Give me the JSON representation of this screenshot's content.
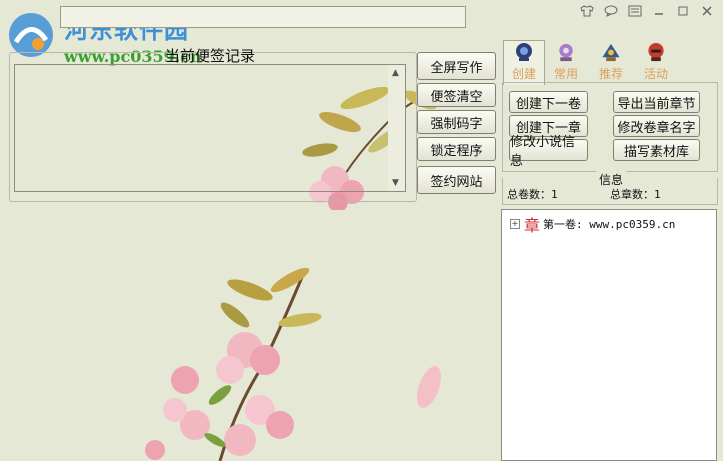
{
  "watermark": {
    "title": "河东软件园",
    "url": "www.pc0359.cn"
  },
  "window": {
    "title": "",
    "icons": [
      "shirt-icon",
      "chat-icon",
      "menu-icon",
      "minimize-icon",
      "maximize-icon",
      "close-icon"
    ]
  },
  "notes": {
    "legend": "当前便签记录",
    "content": ""
  },
  "actions": {
    "fullscreen": "全屏写作",
    "clear_notes": "便签清空",
    "force_code": "强制码字",
    "lock": "锁定程序",
    "sign_site": "签约网站"
  },
  "tabs": [
    {
      "label": "创建",
      "icon": "create-icon"
    },
    {
      "label": "常用",
      "icon": "common-icon"
    },
    {
      "label": "推荐",
      "icon": "recommend-icon"
    },
    {
      "label": "活动",
      "icon": "event-icon"
    }
  ],
  "create_panel": {
    "new_volume": "创建下一卷",
    "new_chapter": "创建下一章",
    "edit_novel": "修改小说信息",
    "export_chapter": "导出当前章节",
    "rename": "修改卷章名字",
    "material": "描写素材库"
  },
  "info": {
    "title": "信息",
    "total_volumes_label": "总卷数：",
    "total_volumes": "1",
    "total_chapters_label": "总章数：",
    "total_chapters": "1"
  },
  "tree": {
    "chapter_glyph": "章",
    "expander": "+",
    "item_label": "第一卷: www.pc0359.cn"
  },
  "colors": {
    "background": "#e6e8d6",
    "tab_label": "#d9a05a",
    "watermark_title": "#3d8fd6",
    "watermark_url": "#3aa030",
    "chapter_glyph": "#d23030"
  }
}
